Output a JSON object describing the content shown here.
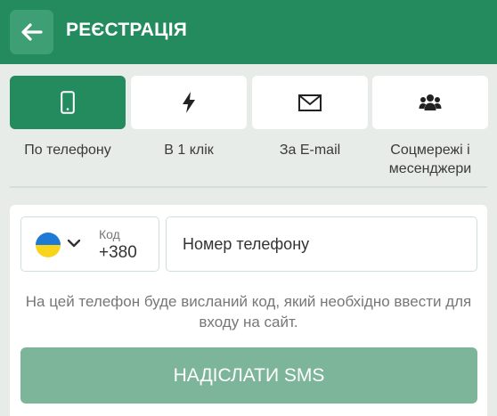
{
  "colors": {
    "brand": "#238b5d",
    "back_button": "#3e9e74",
    "page_bg": "#e7ece9",
    "disabled_button": "#7db59a"
  },
  "header": {
    "title": "РЕЄСТРАЦІЯ",
    "back_icon": "arrow-left-icon"
  },
  "tabs": [
    {
      "label": "По телефону",
      "icon": "smartphone-icon",
      "active": true
    },
    {
      "label": "В 1 клік",
      "icon": "lightning-icon",
      "active": false
    },
    {
      "label": "За E-mail",
      "icon": "envelope-icon",
      "active": false
    },
    {
      "label": "Соцмережі і месенджери",
      "icon": "users-group-icon",
      "active": false
    }
  ],
  "form": {
    "country_code_label": "Код",
    "country_code_value": "+380",
    "country_flag": "ukraine-flag-icon",
    "phone_placeholder": "Номер телефону",
    "hint": "На цей телефон буде висланий код, який необхідно ввести для входу на сайт.",
    "submit_label": "НАДІСЛАТИ SMS"
  }
}
